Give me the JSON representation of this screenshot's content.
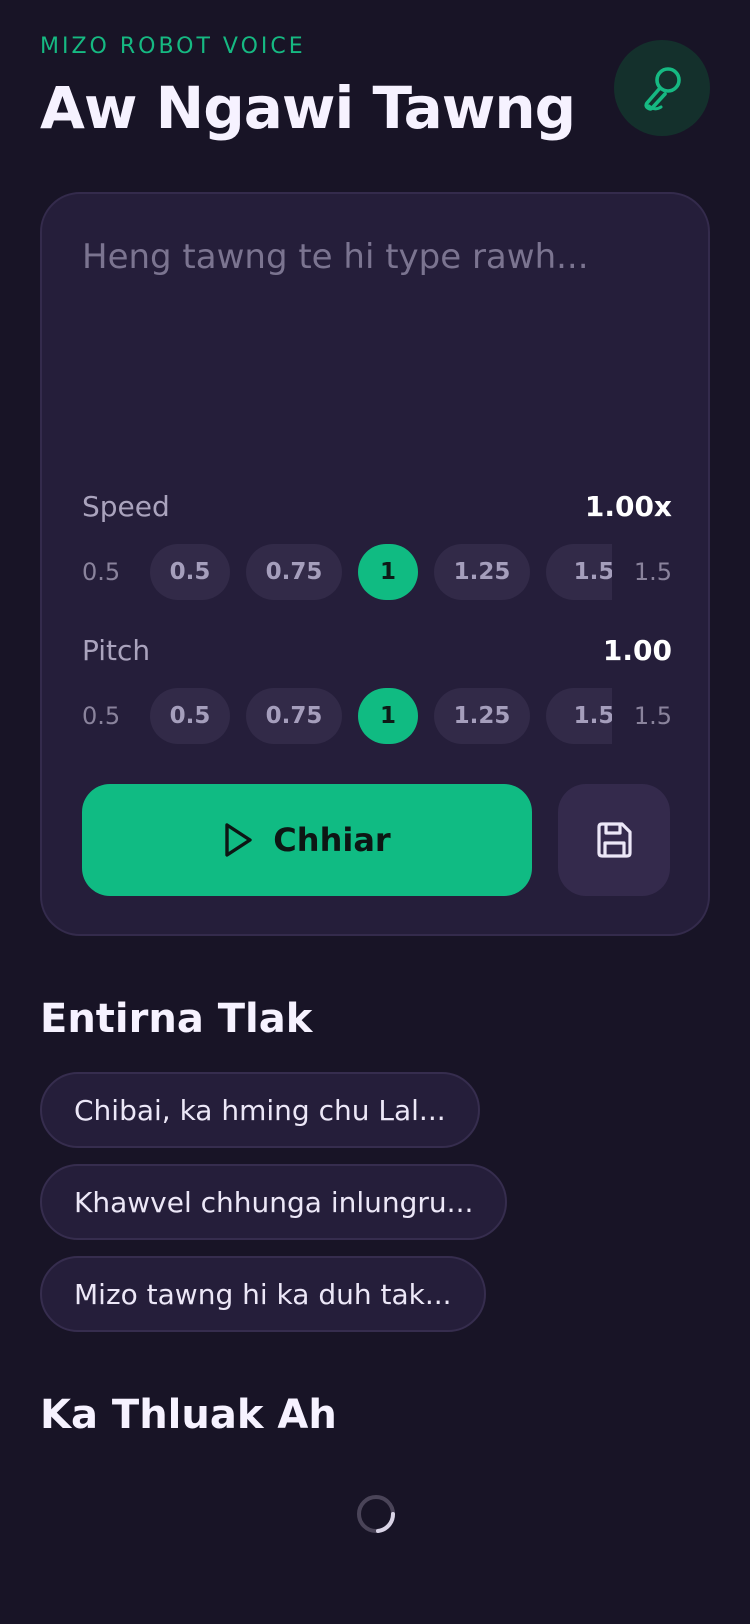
{
  "header": {
    "eyebrow": "MIZO ROBOT VOICE",
    "title": "Aw Ngawi Tawng"
  },
  "input": {
    "placeholder": "Heng tawng te hi type rawh...",
    "value": ""
  },
  "speed": {
    "label": "Speed",
    "value_display": "1.00x",
    "min_label": "0.5",
    "max_label": "1.5",
    "options": [
      "0.5",
      "0.75",
      "1",
      "1.25",
      "1.5"
    ],
    "selected": "1"
  },
  "pitch": {
    "label": "Pitch",
    "value_display": "1.00",
    "min_label": "0.5",
    "max_label": "1.5",
    "options": [
      "0.5",
      "0.75",
      "1",
      "1.25",
      "1.5"
    ],
    "selected": "1"
  },
  "actions": {
    "play_label": "Chhiar"
  },
  "recent": {
    "title": "Entirna Tlak",
    "items": [
      "Chibai, ka hming chu Lal...",
      "Khawvel chhunga inlungru...",
      "Mizo tawng hi ka duh tak..."
    ]
  },
  "saved": {
    "title": "Ka Thluak Ah"
  },
  "colors": {
    "accent": "#10bb83",
    "background": "#181426",
    "card": "#251e3a"
  }
}
